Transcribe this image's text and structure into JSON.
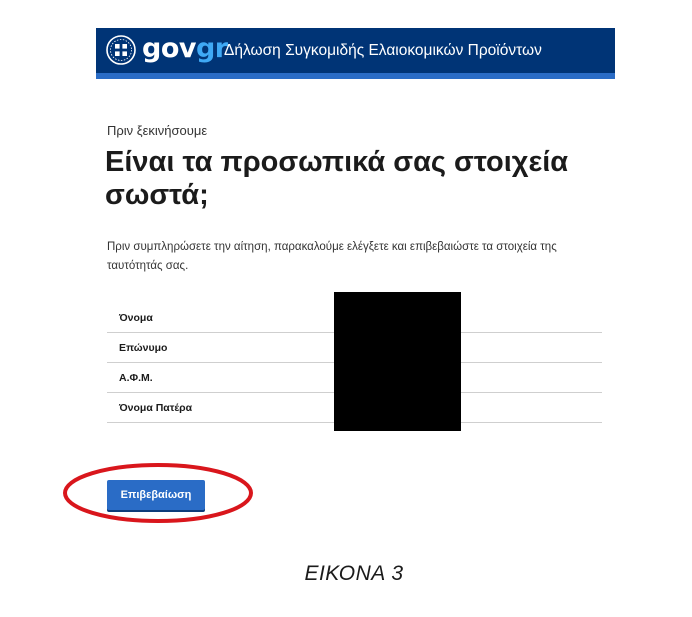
{
  "header": {
    "logo_gov": "gov",
    "logo_gr": "gr",
    "title": "Δήλωση Συγκομιδής Ελαιοκομικών Προϊόντων",
    "bg_color": "#003476",
    "accent_color": "#2a6cc6",
    "emblem_icon": "greek-coat-of-arms-icon"
  },
  "main": {
    "caption": "Πριν ξεκινήσουμε",
    "title": "Είναι τα προσωπικά σας στοιχεία σωστά;",
    "intro": "Πριν συμπληρώσετε την αίτηση, παρακαλούμε ελέγξετε και επιβεβαιώστε τα στοιχεία της ταυτότητάς σας.",
    "details": [
      {
        "label": "Όνομα"
      },
      {
        "label": "Επώνυμο"
      },
      {
        "label": "Α.Φ.Μ."
      },
      {
        "label": "Όνομα Πατέρα"
      }
    ],
    "confirm_label": "Επιβεβαίωση",
    "button_color": "#2a6cc6"
  },
  "annotation": {
    "highlight_color": "#d9161c",
    "figure_caption": "ΕΙΚΟΝΑ 3"
  }
}
